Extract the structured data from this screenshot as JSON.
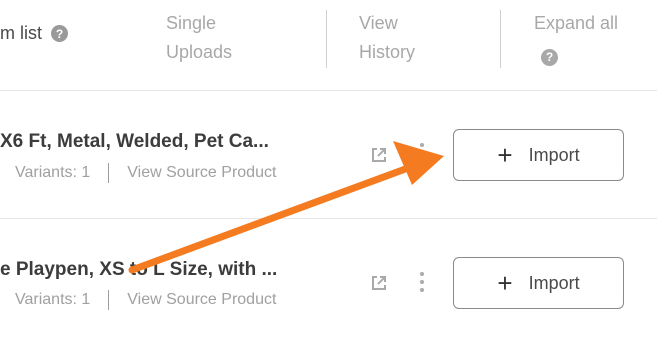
{
  "toolbar": {
    "item_list_label": "m list",
    "help_glyph": "?",
    "single_uploads_line1": "Single",
    "single_uploads_line2": "Uploads",
    "view_history_line1": "View",
    "view_history_line2": "History",
    "expand_all_label": "Expand all"
  },
  "products": [
    {
      "title": "X6 Ft, Metal, Welded, Pet Ca...",
      "variants": "Variants: 1",
      "source_link": "View Source Product",
      "import_label": "Import"
    },
    {
      "title": "e Playpen, XS to L Size, with ...",
      "variants": "Variants: 1",
      "source_link": "View Source Product",
      "import_label": "Import"
    }
  ],
  "colors": {
    "annotation_arrow": "#F47B20"
  }
}
